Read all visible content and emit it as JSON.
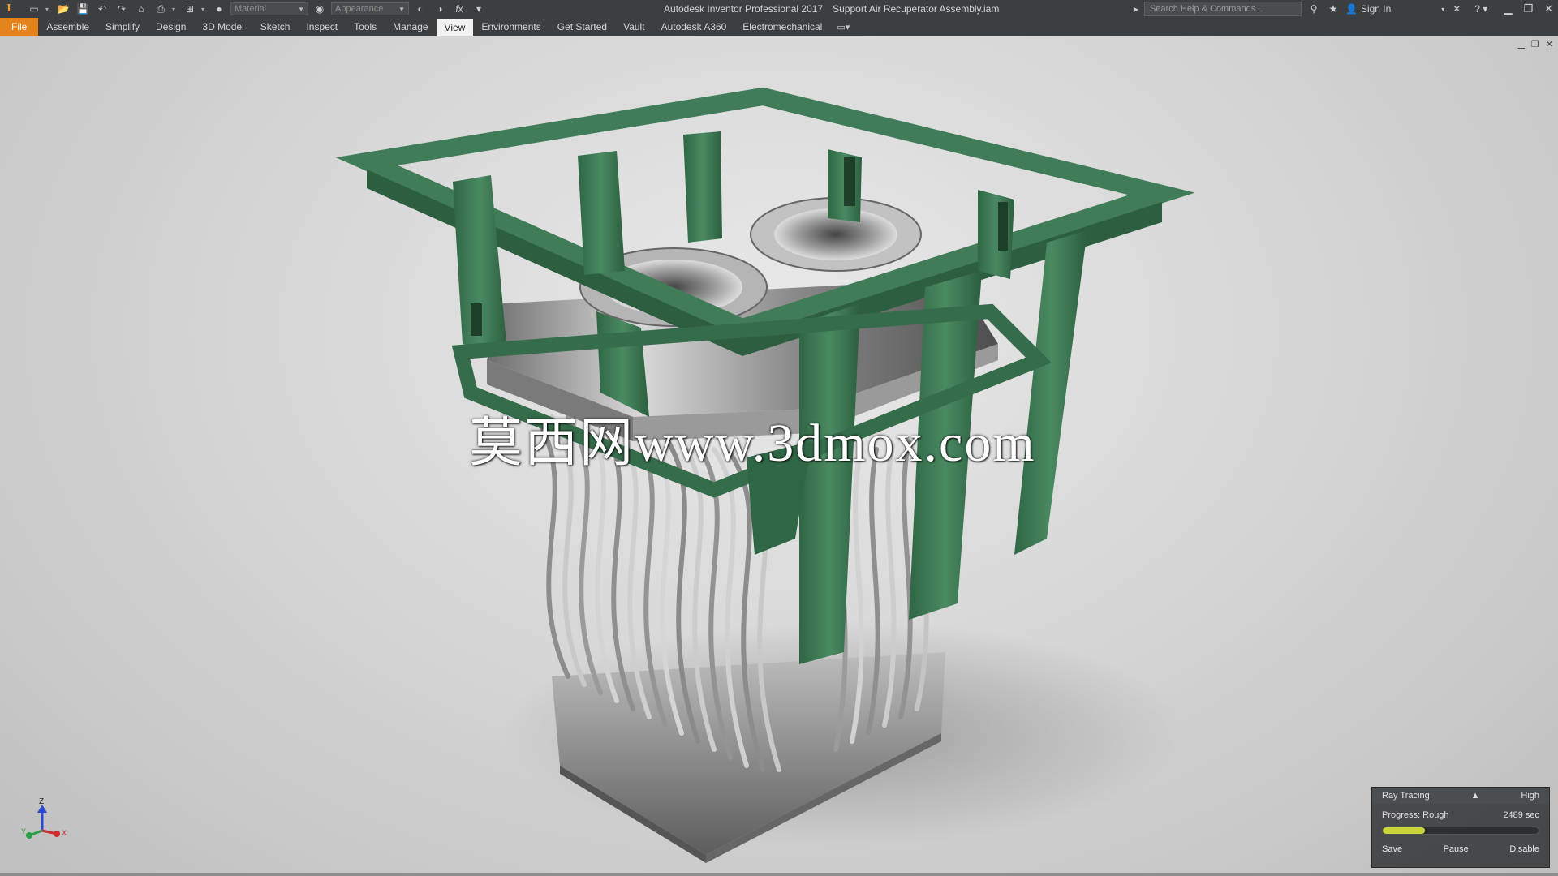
{
  "titlebar": {
    "app_logo": "I",
    "app_title": "Autodesk Inventor Professional 2017",
    "document_title": "Support Air Recuperator Assembly.iam",
    "material_combo": "Material",
    "appearance_combo": "Appearance",
    "search_placeholder": "Search Help & Commands...",
    "sign_in": "Sign In"
  },
  "ribbon": {
    "tabs": [
      "File",
      "Assemble",
      "Simplify",
      "Design",
      "3D Model",
      "Sketch",
      "Inspect",
      "Tools",
      "Manage",
      "View",
      "Environments",
      "Get Started",
      "Vault",
      "Autodesk A360",
      "Electromechanical"
    ],
    "active_tab": "View"
  },
  "viewport": {
    "watermark": "莫西网www.3dmox.com",
    "triad": {
      "z": "Z",
      "y": "Y",
      "x": "X"
    }
  },
  "ray_tracing": {
    "title": "Ray Tracing",
    "quality": "High",
    "progress_label": "Progress: Rough",
    "time": "2489 sec",
    "progress_fraction": 0.27,
    "save": "Save",
    "pause": "Pause",
    "disable": "Disable"
  },
  "colors": {
    "frame_green": "#3e7a55",
    "file_tab": "#e4821c",
    "progress_fill": "#c8d23a"
  }
}
